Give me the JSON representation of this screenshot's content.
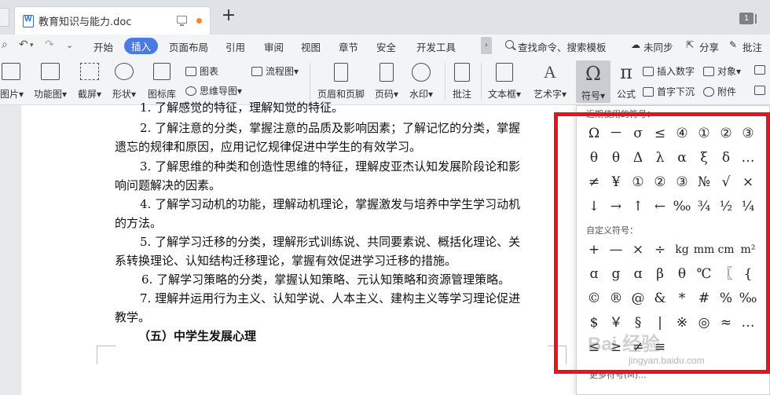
{
  "tabbar": {
    "doc_title": "教育知识与能力.doc",
    "new_tab": "+",
    "tab_count": "1"
  },
  "menubar": {
    "items": [
      "开始",
      "插入",
      "页面布局",
      "引用",
      "审阅",
      "视图",
      "章节",
      "安全",
      "开发工具"
    ],
    "active": "插入",
    "overflow": "›",
    "search": "查找命令、搜索模板",
    "right": [
      "未同步",
      "分享",
      "批注"
    ]
  },
  "ribbon": {
    "picture": "图片▾",
    "function_chart": "功能图▾",
    "screenshot": "截屏▾",
    "shape": "形状▾",
    "icon_lib": "图标库",
    "chart": "图表",
    "mindmap": "思维导图▾",
    "flowchart": "流程图▾",
    "header_footer": "页眉和页脚",
    "page_number": "页码▾",
    "watermark": "水印▾",
    "comment": "批注",
    "textbox": "文本框▾",
    "wordart": "艺术字▾",
    "symbol": "符号▾",
    "formula": "公式",
    "insert_number": "插入数字",
    "object": "对象▾",
    "dropcap": "首字下沉",
    "attachment": "附件"
  },
  "document": {
    "lines": [
      "1. 了解感觉的特征，理解知觉的特征。",
      "2. 了解注意的分类，掌握注意的品质及影响因素；了解记忆的分类，掌握",
      "遗忘的规律和原因，应用记忆规律促进中学生的有效学习。",
      "3. 了解思维的种类和创造性思维的特征，理解皮亚杰认知发展阶段论和影",
      "响问题解决的因素。",
      "4. 了解学习动机的功能，理解动机理论，掌握激发与培养中学生学习动机",
      "的方法。",
      "5. 了解学习迁移的分类，理解形式训练说、共同要素说、概括化理论、关",
      "系转换理论、认知结构迁移理论，掌握有效促进学习迁移的措施。",
      "6. 了解学习策略的分类，掌握认知策略、元认知策略和资源管理策略。",
      "7. 理解并运用行为主义、认知学说、人本主义、建构主义等学习理论促进",
      "教学。"
    ],
    "heading": "（五）中学生发展心理"
  },
  "symbols": {
    "recent_title": "近期使用的符号：",
    "recent": [
      "Ω",
      "－",
      "σ",
      "≤",
      "④",
      "①",
      "②",
      "③",
      "θ",
      "θ",
      "Δ",
      "λ",
      "α",
      "ξ",
      "δ",
      "…",
      "≠",
      "¥",
      "①",
      "②",
      "③",
      "№",
      "√",
      "×",
      "↓",
      "→",
      "↑",
      "←",
      "‰",
      "¾",
      "½",
      "¼"
    ],
    "custom_title": "自定义符号：",
    "custom": [
      "+",
      "—",
      "×",
      "÷",
      "kg",
      "mm",
      "cm",
      "m²",
      "ɑ",
      "g",
      "ɑ",
      "β",
      "θ",
      "℃",
      "〖",
      "{",
      "©",
      "®",
      "@",
      "&",
      "*",
      "#",
      "%",
      "‰",
      "$",
      "￥",
      "§",
      "|",
      "※",
      "◎",
      "≈",
      "…",
      "≤",
      "≥",
      "≠",
      "≡"
    ],
    "footer": "更多符号(M)..."
  },
  "watermark": {
    "text": "Bai 经验",
    "sub": "jingyan.baidu.com"
  },
  "colors": {
    "accent": "#4b7be0",
    "highlight": "#e8131d",
    "unsaved_dot": "#f08a24"
  }
}
